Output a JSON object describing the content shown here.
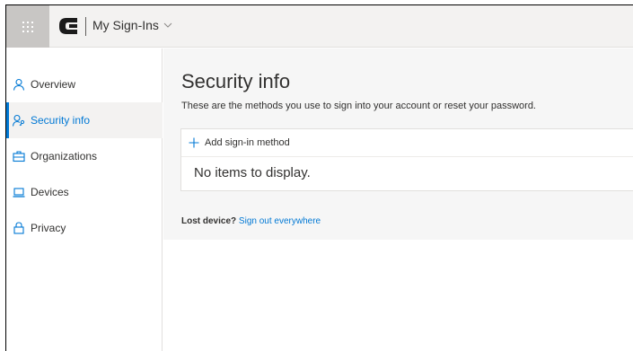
{
  "header": {
    "app_title": "My Sign-Ins"
  },
  "sidebar": {
    "items": [
      {
        "label": "Overview",
        "icon": "person-icon"
      },
      {
        "label": "Security info",
        "icon": "security-info-icon"
      },
      {
        "label": "Organizations",
        "icon": "briefcase-icon"
      },
      {
        "label": "Devices",
        "icon": "laptop-icon"
      },
      {
        "label": "Privacy",
        "icon": "lock-icon"
      }
    ],
    "active_index": 1
  },
  "main": {
    "title": "Security info",
    "description": "These are the methods you use to sign into your account or reset your password.",
    "add_method_label": "Add sign-in method",
    "empty_text": "No items to display.",
    "lost_device_label": "Lost device?",
    "sign_out_link": "Sign out everywhere"
  },
  "colors": {
    "accent": "#0078d4",
    "content_bg": "#f6f6f6",
    "topbar_bg": "#f3f2f1"
  }
}
